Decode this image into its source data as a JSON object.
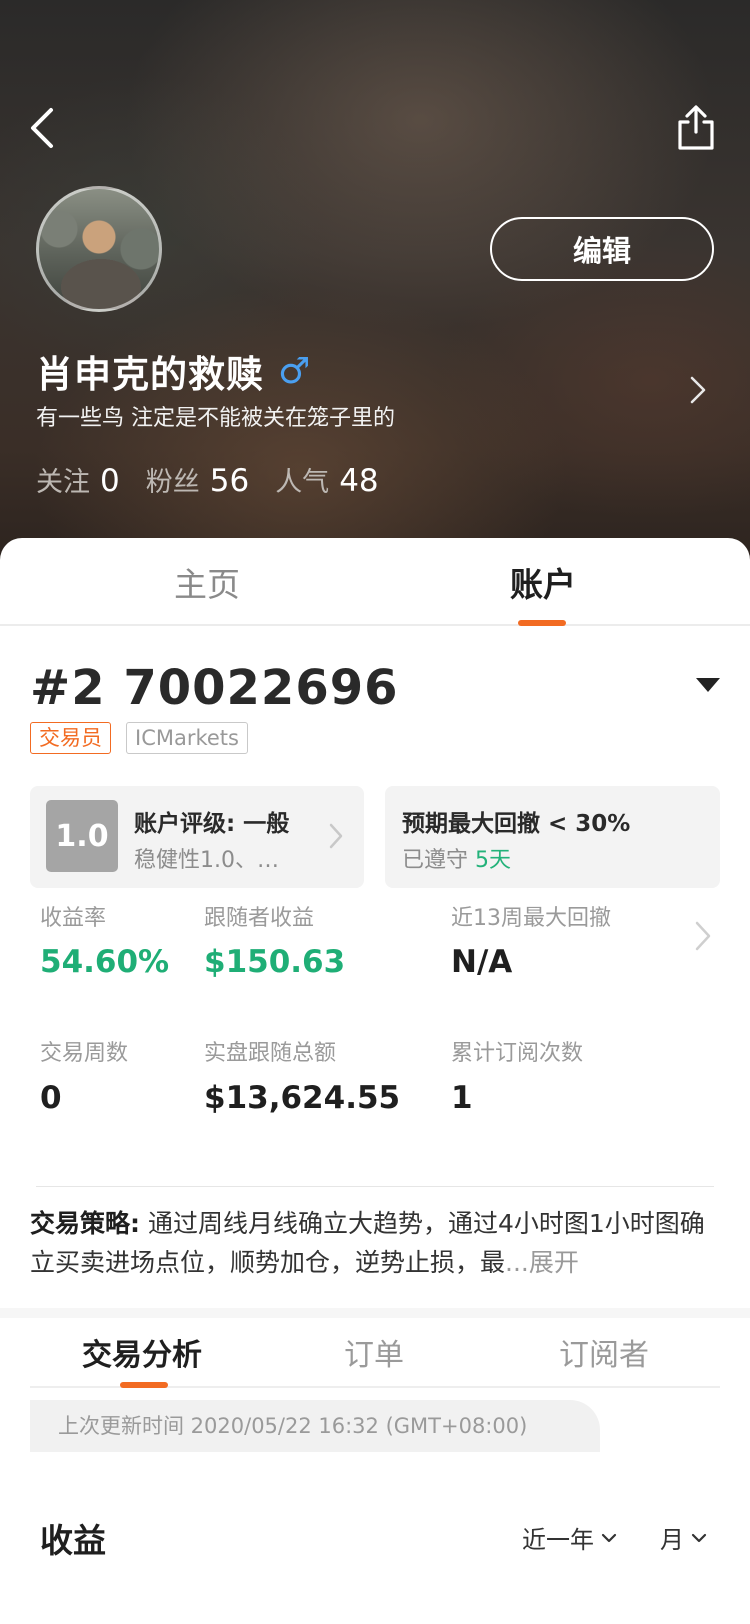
{
  "header": {
    "edit_label": "编辑",
    "username": "肖申克的救赎",
    "gender_symbol": "♂",
    "bio": "有一些鸟 注定是不能被关在笼子里的",
    "stats": [
      {
        "label": "关注",
        "value": "0"
      },
      {
        "label": "粉丝",
        "value": "56"
      },
      {
        "label": "人气",
        "value": "48"
      }
    ]
  },
  "main_tabs": [
    {
      "label": "主页",
      "active": false
    },
    {
      "label": "账户",
      "active": true
    }
  ],
  "account": {
    "number": "#2 70022696",
    "tags": [
      "交易员",
      "ICMarkets"
    ],
    "rating_card": {
      "score": "1.0",
      "title": "账户评级: 一般",
      "subtitle": "稳健性1.0、…"
    },
    "drawdown_card": {
      "title": "预期最大回撤 < 30%",
      "subtitle_prefix": "已遵守",
      "days": "5天"
    }
  },
  "metrics": [
    {
      "label": "收益率",
      "value": "54.60%"
    },
    {
      "label": "跟随者收益",
      "value": "$150.63"
    },
    {
      "label": "近13周最大回撤",
      "value": "N/A"
    },
    {
      "label": "交易周数",
      "value": "0"
    },
    {
      "label": "实盘跟随总额",
      "value": "$13,624.55"
    },
    {
      "label": "累计订阅次数",
      "value": "1"
    }
  ],
  "strategy": {
    "label": "交易策略:",
    "text": " 通过周线月线确立大趋势，通过4小时图1小时图确立买卖进场点位，顺势加仓，逆势止损，最",
    "ellipsis": "...",
    "expand": "展开"
  },
  "sub_tabs": [
    {
      "label": "交易分析",
      "active": true
    },
    {
      "label": "订单",
      "active": false
    },
    {
      "label": "订阅者",
      "active": false
    }
  ],
  "update_time": "上次更新时间 2020/05/22 16:32 (GMT+08:00)",
  "earnings": {
    "title": "收益",
    "period_filter": "近一年",
    "granularity_filter": "月"
  },
  "colors": {
    "accent": "#f26b22",
    "positive": "#1fae76",
    "gender": "#4a9ff0"
  },
  "icons": {
    "back": "chevron-left-icon",
    "share": "share-icon",
    "dropdown": "caret-down-icon",
    "arrow": "chevron-right-icon"
  }
}
